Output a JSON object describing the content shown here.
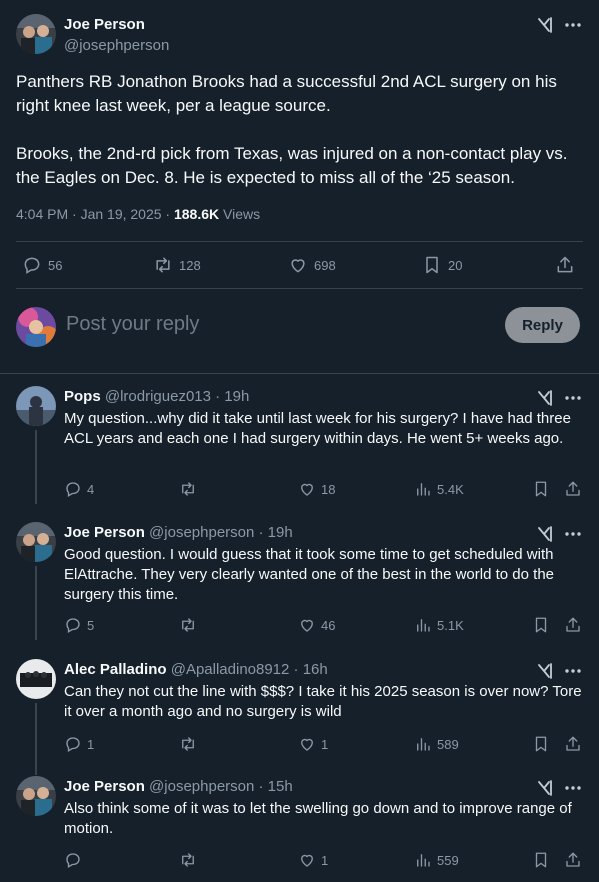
{
  "post": {
    "author_name": "Joe Person",
    "author_handle": "@josephperson",
    "paragraph1": "Panthers RB Jonathon Brooks had a successful 2nd ACL surgery on his right knee last week, per a league source.",
    "paragraph2": "Brooks, the 2nd-rd pick from Texas, was injured on a non-contact play vs. the Eagles on Dec. 8. He is expected to miss all of the ‘25 season.",
    "timestamp": "4:04 PM · Jan 19, 2025 · ",
    "views_count": "188.6K",
    "views_label": " Views",
    "replies": "56",
    "reposts": "128",
    "likes": "698",
    "bookmarks": "20"
  },
  "composer": {
    "placeholder": "Post your reply",
    "button_label": "Reply"
  },
  "replies": [
    {
      "name": "Pops",
      "handle_time": " @lrodriguez013 · 19h",
      "text": "My question...why did it take until last week for his surgery? I have had three ACL years and each one I had surgery within days. He went 5+ weeks ago.",
      "replies": "4",
      "reposts": "",
      "likes": "18",
      "views": "5.4K"
    },
    {
      "name": "Joe Person",
      "handle_time": " @josephperson · 19h",
      "text": "Good question. I would guess that it took some time to get scheduled with ElAttrache. They very clearly wanted one of the best in the world to do the surgery this time.",
      "replies": "5",
      "reposts": "",
      "likes": "46",
      "views": "5.1K"
    },
    {
      "name": "Alec Palladino",
      "handle_time": " @Apalladino8912 · 16h",
      "text": "Can they not cut the line with $$$? I take it his 2025 season is over now? Tore it over a month ago and no surgery is wild",
      "replies": "1",
      "reposts": "",
      "likes": "1",
      "views": "589"
    },
    {
      "name": "Joe Person",
      "handle_time": " @josephperson · 15h",
      "text": "Also think some of it was to let the swelling go down and to improve range of motion.",
      "replies": "",
      "reposts": "",
      "likes": "1",
      "views": "559"
    }
  ],
  "icons": {
    "reply": "reply-icon",
    "repost": "repost-icon",
    "like": "heart-icon",
    "views": "views-icon",
    "bookmark": "bookmark-icon",
    "share": "share-icon",
    "grok": "grok-icon",
    "more": "more-icon"
  },
  "colors": {
    "background": "#15202b",
    "text_primary": "#f7f9f9",
    "text_secondary": "#8b98a5",
    "divider": "#38444d",
    "reply_button": "#8d9298"
  }
}
